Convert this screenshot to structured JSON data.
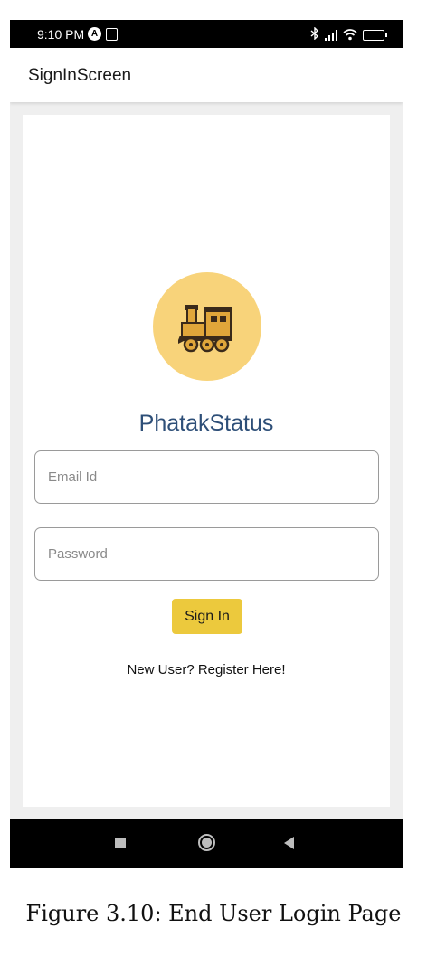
{
  "status_bar": {
    "time": "9:10 PM",
    "icons": [
      "alpha-icon",
      "sim-icon",
      "bluetooth-icon",
      "signal-icon",
      "wifi-icon",
      "battery-icon"
    ],
    "battery_color": "#f5c400"
  },
  "app_bar": {
    "title": "SignInScreen"
  },
  "logo": {
    "icon": "train-icon",
    "background": "#f8d37a"
  },
  "brand": {
    "name": "PhatakStatus",
    "color": "#2e4f78"
  },
  "form": {
    "email_placeholder": "Email Id",
    "email_value": "",
    "password_placeholder": "Password",
    "password_value": "",
    "signin_label": "Sign In",
    "signin_color": "#ecc93d",
    "register_label": "New User? Register Here!"
  },
  "nav_bar": {
    "icons": [
      "recent-apps-icon",
      "home-icon",
      "back-icon"
    ]
  },
  "caption": "Figure 3.10: End User Login Page"
}
